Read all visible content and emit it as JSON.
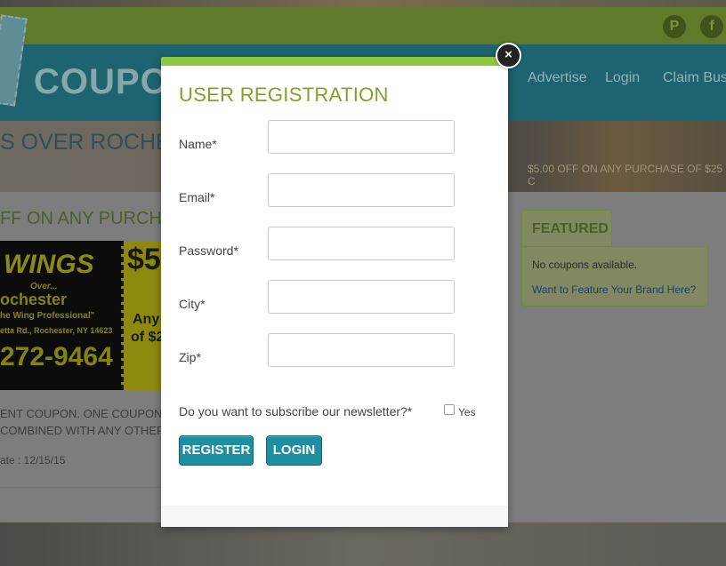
{
  "background": {
    "brand_text": "COUPO",
    "nav": [
      "Advertise",
      "Login",
      "Claim Bus"
    ],
    "social": [
      "pinterest-icon",
      "facebook-icon"
    ],
    "hero_title": "S OVER ROCHE",
    "hero_sub": "$5.00 OFF ON ANY PURCHASE OF $25 C",
    "coupon_heading": "FF ON ANY PURCHA",
    "coupon_image": {
      "lines": [
        "WINGS",
        "Over...",
        "ochester",
        "he Wing Professional\"",
        "etta Rd., Rochester, NY 14623",
        "272-9464",
        "$5",
        "Any",
        "of $2"
      ]
    },
    "coupon_desc": [
      "ENT COUPON. ONE COUPON",
      " COMBINED WITH ANY OTHER"
    ],
    "coupon_date": "ate : 12/15/15",
    "featured": {
      "tab": "FEATURED",
      "empty": "No coupons available.",
      "link": "Want to Feature Your Brand Here?"
    }
  },
  "modal": {
    "title": "USER REGISTRATION",
    "close_symbol": "×",
    "fields": [
      {
        "label": "Name*",
        "value": "",
        "placeholder": ""
      },
      {
        "label": "Email*",
        "value": "",
        "placeholder": ""
      },
      {
        "label": "Password*",
        "value": "",
        "placeholder": ""
      },
      {
        "label": "City*",
        "value": "",
        "placeholder": ""
      },
      {
        "label": "Zip*",
        "value": "",
        "placeholder": ""
      }
    ],
    "newsletter_question": "Do you want to subscribe our newsletter?*",
    "newsletter_option": "Yes",
    "newsletter_checked": false,
    "register_label": "REGISTER",
    "login_label": "LOGIN"
  },
  "colors": {
    "accent_green": "#8dc63f",
    "title_green": "#7ba428",
    "button_teal": "#1d8fa0"
  }
}
